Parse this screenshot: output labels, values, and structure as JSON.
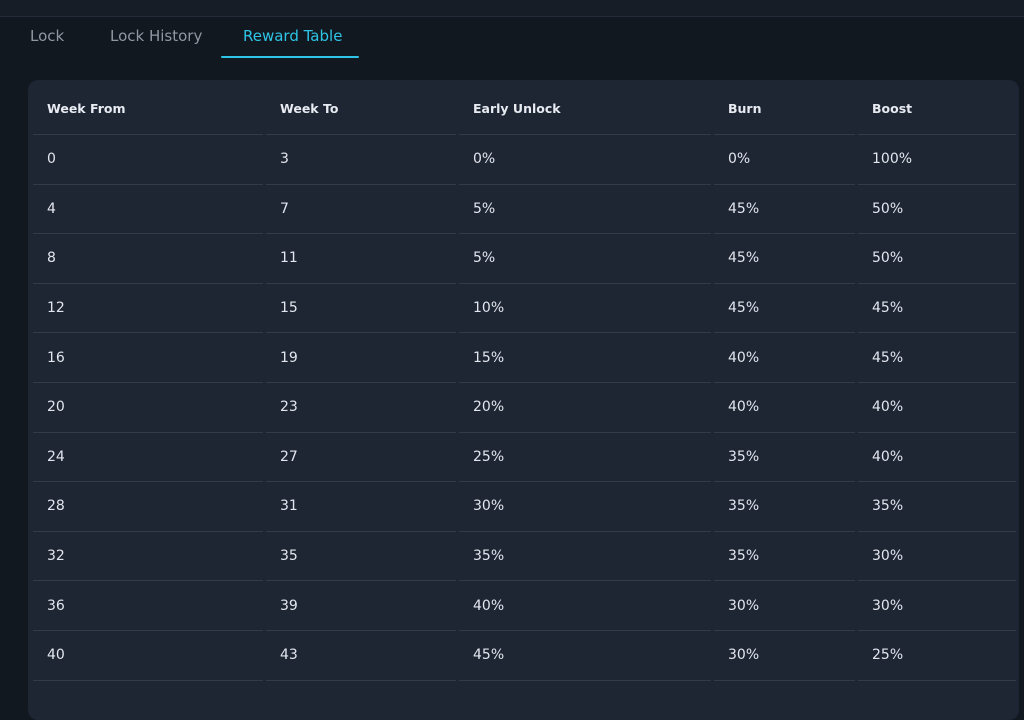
{
  "tabs": [
    {
      "label": "Lock"
    },
    {
      "label": "Lock History"
    },
    {
      "label": "Reward Table",
      "active": true
    }
  ],
  "colors": {
    "accent": "#2ec4e6",
    "background": "#111820",
    "card": "#1e2533",
    "divider": "#323b4a"
  },
  "table": {
    "columns": [
      "Week From",
      "Week To",
      "Early Unlock",
      "Burn",
      "Boost"
    ],
    "rows": [
      [
        "0",
        "3",
        "0%",
        "0%",
        "100%"
      ],
      [
        "4",
        "7",
        "5%",
        "45%",
        "50%"
      ],
      [
        "8",
        "11",
        "5%",
        "45%",
        "50%"
      ],
      [
        "12",
        "15",
        "10%",
        "45%",
        "45%"
      ],
      [
        "16",
        "19",
        "15%",
        "40%",
        "45%"
      ],
      [
        "20",
        "23",
        "20%",
        "40%",
        "40%"
      ],
      [
        "24",
        "27",
        "25%",
        "35%",
        "40%"
      ],
      [
        "28",
        "31",
        "30%",
        "35%",
        "35%"
      ],
      [
        "32",
        "35",
        "35%",
        "35%",
        "30%"
      ],
      [
        "36",
        "39",
        "40%",
        "30%",
        "30%"
      ],
      [
        "40",
        "43",
        "45%",
        "30%",
        "25%"
      ]
    ]
  }
}
